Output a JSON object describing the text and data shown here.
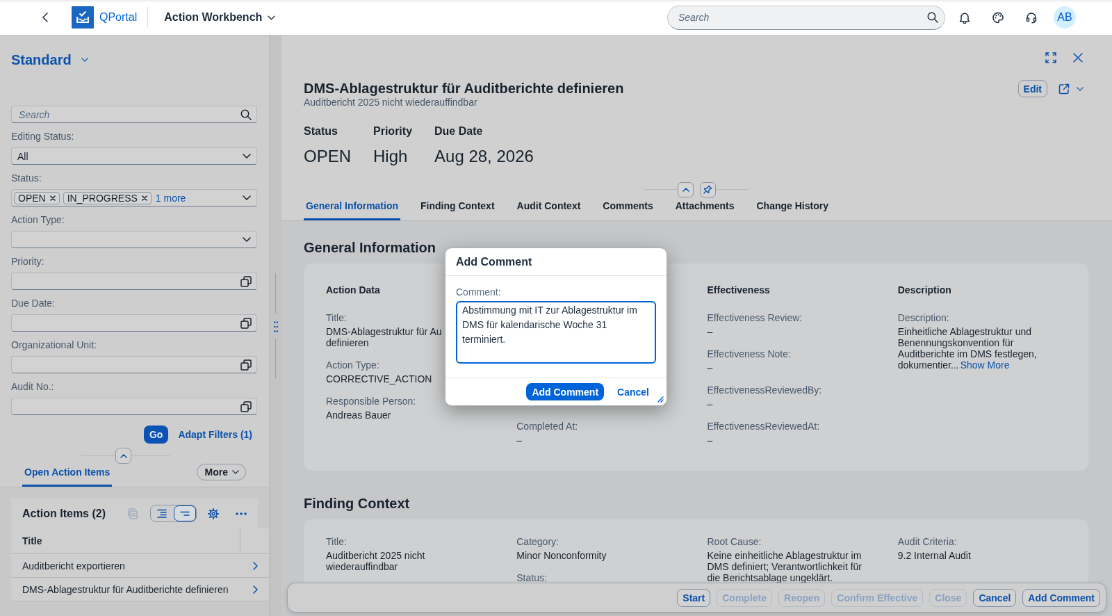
{
  "shell": {
    "logo_text": "QPortal",
    "app_title": "Action Workbench",
    "search": {
      "placeholder": "Search"
    },
    "avatar": "AB"
  },
  "filter_panel": {
    "variant": "Standard",
    "search": {
      "placeholder": "Search"
    },
    "filters": [
      {
        "kind": "select",
        "label": "Editing Status:",
        "value": "All"
      },
      {
        "kind": "tokens",
        "label": "Status:",
        "tokens": [
          "OPEN",
          "IN_PROGRESS"
        ],
        "more": "1 more"
      },
      {
        "kind": "select",
        "label": "Action Type:"
      },
      {
        "kind": "value_help",
        "label": "Priority:"
      },
      {
        "kind": "value_help",
        "label": "Due Date:"
      },
      {
        "kind": "value_help",
        "label": "Organizational Unit:"
      },
      {
        "kind": "value_help",
        "label": "Audit No.:"
      }
    ],
    "go": "Go",
    "adapt_filters": "Adapt Filters (1)"
  },
  "list_tabs": [
    {
      "label": "Open Action Items",
      "selected": true
    }
  ],
  "more_menu": "More",
  "table": {
    "title": "Action Items (2)",
    "copy_disabled": true,
    "view_modes": [
      {
        "kind": "expand",
        "selected": false
      },
      {
        "kind": "collapse",
        "selected": true
      }
    ],
    "columns": [
      "Title"
    ],
    "rows": [
      "Auditbericht exportieren",
      "DMS-Ablagestruktur für Auditberichte definieren"
    ]
  },
  "object_page": {
    "title": "DMS-Ablagestruktur für Auditberichte definieren",
    "subtitle": "Auditbericht 2025 nicht wiederauffindbar",
    "edit": "Edit",
    "kpis": [
      {
        "label": "Status",
        "value": "OPEN"
      },
      {
        "label": "Priority",
        "value": "High"
      },
      {
        "label": "Due Date",
        "value": "Aug 28, 2026"
      }
    ],
    "tabs": [
      {
        "label": "General Information",
        "selected": true
      },
      {
        "label": "Finding Context",
        "selected": false
      },
      {
        "label": "Audit Context",
        "selected": false
      },
      {
        "label": "Comments",
        "selected": false
      },
      {
        "label": "Attachments",
        "selected": false
      },
      {
        "label": "Change History",
        "selected": false
      }
    ],
    "sections": [
      {
        "title": "General Information",
        "groups": [
          {
            "title": "Action Data",
            "fields": [
              {
                "label": "Title:",
                "value": "DMS-Ablagestruktur für Au\ndefinieren"
              },
              {
                "label": "Action Type:",
                "value": "CORRECTIVE_ACTION"
              },
              {
                "label": "Responsible Person:",
                "value": "Andreas Bauer"
              }
            ]
          },
          {
            "fields": [
              {
                "label": "Completed At:",
                "value": "–"
              }
            ]
          },
          {
            "title": "Effectiveness",
            "fields": [
              {
                "label": "Effectiveness Review:",
                "value": "–"
              },
              {
                "label": "Effectiveness Note:",
                "value": "–"
              },
              {
                "label": "EffectivenessReviewedBy:",
                "value": "–"
              },
              {
                "label": "EffectivenessReviewedAt:",
                "value": "–"
              }
            ]
          },
          {
            "title": "Description",
            "fields": [
              {
                "label": "Description:",
                "value": "Einheitliche Ablagestruktur und Benennungskonvention für Auditberichte im DMS festlegen, dokumentier...",
                "link": "Show More"
              }
            ]
          }
        ]
      },
      {
        "title": "Finding Context",
        "groups": [
          {
            "fields": [
              {
                "label": "Title:",
                "value": "Auditbericht 2025 nicht wiederauffindbar"
              }
            ]
          },
          {
            "fields": [
              {
                "label": "Category:",
                "value": "Minor Nonconformity"
              },
              {
                "label": "Status:"
              }
            ]
          },
          {
            "fields": [
              {
                "label": "Root Cause:",
                "value": "Keine einheitliche Ablagestruktur im DMS definiert; Verantwortlichkeit für die Berichtsablage ungeklärt."
              }
            ]
          },
          {
            "fields": [
              {
                "label": "Audit Criteria:",
                "value": "9.2 Internal Audit"
              }
            ]
          }
        ]
      }
    ]
  },
  "footer_actions": [
    {
      "label": "Start",
      "disabled": false
    },
    {
      "label": "Complete",
      "disabled": true
    },
    {
      "label": "Reopen",
      "disabled": true
    },
    {
      "label": "Confirm Effective",
      "disabled": true
    },
    {
      "label": "Close",
      "disabled": true
    },
    {
      "label": "Cancel",
      "disabled": false
    },
    {
      "label": "Add Comment",
      "disabled": false
    }
  ],
  "dialog": {
    "title": "Add Comment",
    "field_label": "Comment:",
    "value": "Abstimmung mit IT zur Ablagestruktur im DMS für kalendarische Woche 31 terminiert.",
    "confirm": "Add Comment",
    "cancel": "Cancel"
  }
}
